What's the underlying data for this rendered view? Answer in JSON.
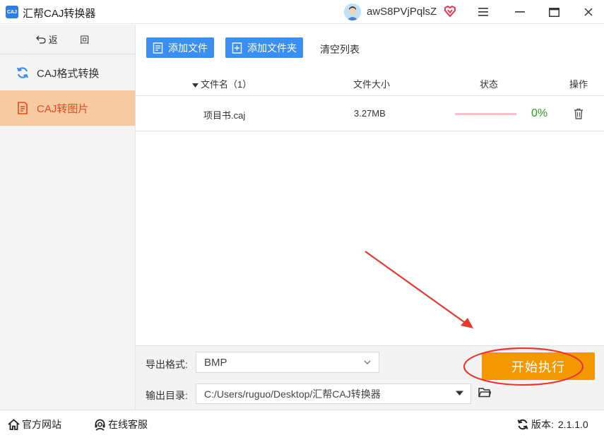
{
  "app": {
    "logo_text": "CAJ",
    "title": "汇帮CAJ转换器",
    "user_name": "awS8PVjPqlsZ",
    "accent": "#3b8ff0",
    "active_color": "#e04b1f"
  },
  "sidebar": {
    "back_label": "返 回",
    "items": [
      {
        "label": "CAJ格式转换",
        "icon": "refresh-icon"
      },
      {
        "label": "CAJ转图片",
        "icon": "document-icon"
      }
    ]
  },
  "toolbar": {
    "add_file_label": "添加文件",
    "add_folder_label": "添加文件夹",
    "clear_label": "清空列表"
  },
  "table": {
    "headers": {
      "name": "文件名（1）",
      "size": "文件大小",
      "status": "状态",
      "action": "操作"
    },
    "rows": [
      {
        "name": "项目书.caj",
        "size": "3.27MB",
        "progress": "0%"
      }
    ]
  },
  "output": {
    "format_label": "导出格式:",
    "format_value": "BMP",
    "dir_label": "输出目录:",
    "dir_value": "C:/Users/ruguo/Desktop/汇帮CAJ转换器",
    "start_label": "开始执行"
  },
  "statusbar": {
    "website_label": "官方网站",
    "service_label": "在线客服",
    "version_label": "版本:",
    "version_value": "2.1.1.0"
  }
}
